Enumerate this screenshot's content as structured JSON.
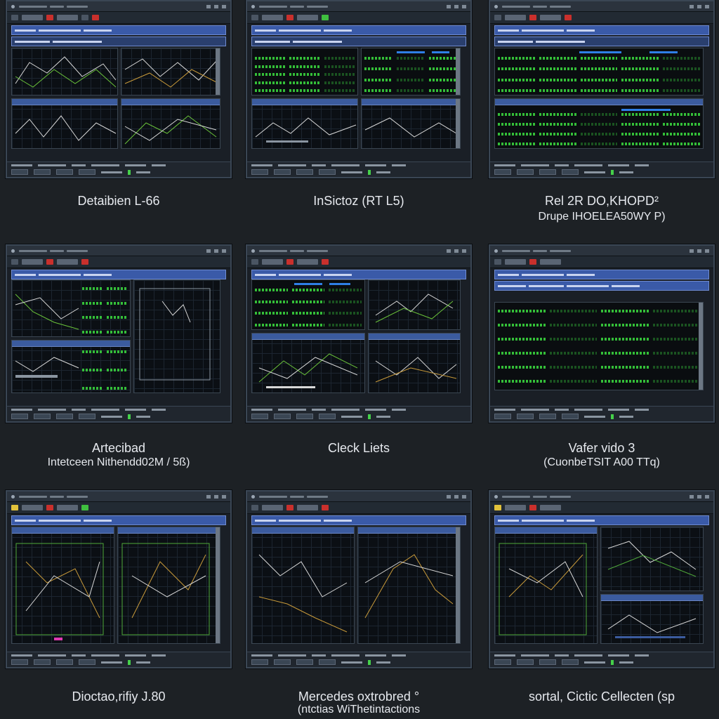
{
  "captions": [
    {
      "line1": "Detaibien L-66",
      "line2": ""
    },
    {
      "line1": "InSictoz (RT L5)",
      "line2": ""
    },
    {
      "line1": "Rel 2R DO,KHOPD²",
      "line2": "Drupe IHOELEA50WY P)"
    },
    {
      "line1": "Artecibad",
      "line2": "Intetceen Nithendd02M / 5ß)"
    },
    {
      "line1": "Cleck Liets",
      "line2": ""
    },
    {
      "line1": "Vafer vido 3",
      "line2": "(CuonbeTSIT A00 TTq)"
    },
    {
      "line1": "Dioctao,rifiy J.80",
      "line2": ""
    },
    {
      "line1": "Mercedes oxtrobred °",
      "line2": "(ntctias WiThetintactions"
    },
    {
      "line1": "sortal, Cictic Cellecten (sp",
      "line2": ""
    }
  ],
  "colors": {
    "background": "#1d2125",
    "panel_header": "#3b5b9e",
    "data_green": "#38d13d",
    "accent_blue": "#2f7fe6",
    "alert_red": "#c9302c"
  },
  "icons": [
    "minimize-icon",
    "maximize-icon",
    "close-icon",
    "record-icon",
    "status-led-icon"
  ]
}
